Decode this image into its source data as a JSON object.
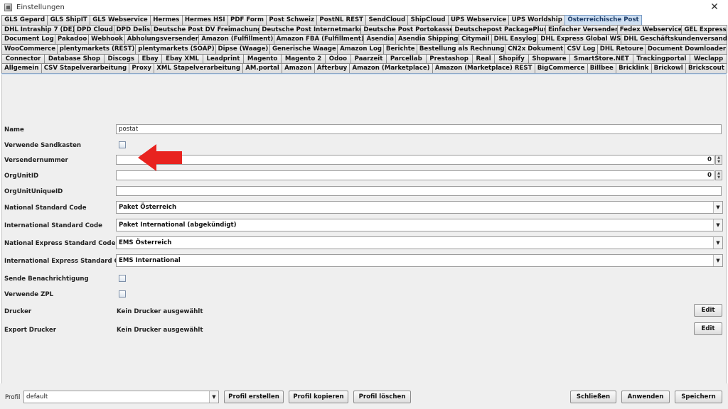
{
  "window": {
    "title": "Einstellungen",
    "close": "✕"
  },
  "tab_rows": [
    [
      "GLS Gepard",
      "GLS ShipIT",
      "GLS Webservice",
      "Hermes",
      "Hermes HSI",
      "PDF Form",
      "Post Schweiz",
      "PostNL REST",
      "SendCloud",
      "ShipCloud",
      "UPS Webservice",
      "UPS Worldship",
      "Österreichische Post"
    ],
    [
      "DHL Intraship 7 (DE)",
      "DPD Cloud",
      "DPD Delis",
      "Deutsche Post DV Freimachung",
      "Deutsche Post Internetmarke",
      "Deutsche Post Portokasse",
      "Deutschepost PackagePlus",
      "Einfacher Versender",
      "Fedex Webservice",
      "GEL Express"
    ],
    [
      "Document Log",
      "Pakadoo",
      "Webhook",
      "Abholungsversender",
      "Amazon (Fulfillment)",
      "Amazon FBA (Fulfillment)",
      "Asendia",
      "Asendia Shipping",
      "Citymail",
      "DHL Easylog",
      "DHL Express Global WS",
      "DHL Geschäftskundenversand"
    ],
    [
      "WooCommerce",
      "plentymarkets (REST)",
      "plentymarkets (SOAP)",
      "Dipse (Waage)",
      "Generische Waage",
      "Amazon Log",
      "Berichte",
      "Bestellung als Rechnung",
      "CN2x Dokument",
      "CSV Log",
      "DHL Retoure",
      "Document Downloader"
    ],
    [
      "Connector",
      "Database Shop",
      "Discogs",
      "Ebay",
      "Ebay XML",
      "Leadprint",
      "Magento",
      "Magento 2",
      "Odoo",
      "Paarzeit",
      "Parcellab",
      "Prestashop",
      "Real",
      "Shopify",
      "Shopware",
      "SmartStore.NET",
      "Trackingportal",
      "Weclapp"
    ],
    [
      "Allgemein",
      "CSV Stapelverarbeitung",
      "Proxy",
      "XML Stapelverarbeitung",
      "AM.portal",
      "Amazon",
      "Afterbuy",
      "Amazon (Marketplace)",
      "Amazon (Marketplace) REST",
      "BigCommerce",
      "Billbee",
      "Bricklink",
      "Brickowl",
      "Brickscout"
    ]
  ],
  "active_tab": "Österreichische Post",
  "form": {
    "name_label": "Name",
    "name_value": "postat",
    "sandbox_label": "Verwende Sandkasten",
    "sender_number_label": "Versendernummer",
    "sender_number_value": "0",
    "orgunit_label": "OrgUnitID",
    "orgunit_value": "0",
    "orgunit_unique_label": "OrgUnitUniqueID",
    "orgunit_unique_value": "",
    "national_label": "National Standard Code",
    "national_value": "Paket Österreich",
    "international_label": "International Standard Code",
    "international_value": "Paket International (abgekündigt)",
    "national_express_label": "National Express Standard Code",
    "national_express_value": "EMS Österreich",
    "international_express_label": "International Express Standard Code",
    "international_express_value": "EMS International",
    "notify_label": "Sende Benachrichtigung",
    "zpl_label": "Verwende ZPL",
    "printer_label": "Drucker",
    "printer_value": "Kein Drucker ausgewählt",
    "export_printer_label": "Export Drucker",
    "export_printer_value": "Kein Drucker ausgewählt",
    "edit_label": "Edit"
  },
  "bottom": {
    "profil_label": "Profil",
    "profil_value": "default",
    "create": "Profil erstellen",
    "copy": "Profil kopieren",
    "delete": "Profil löschen",
    "close": "Schließen",
    "apply": "Anwenden",
    "save": "Speichern"
  },
  "colors": {
    "annotation_arrow": "#e8231f",
    "active_tab": "#cfe0f2"
  }
}
